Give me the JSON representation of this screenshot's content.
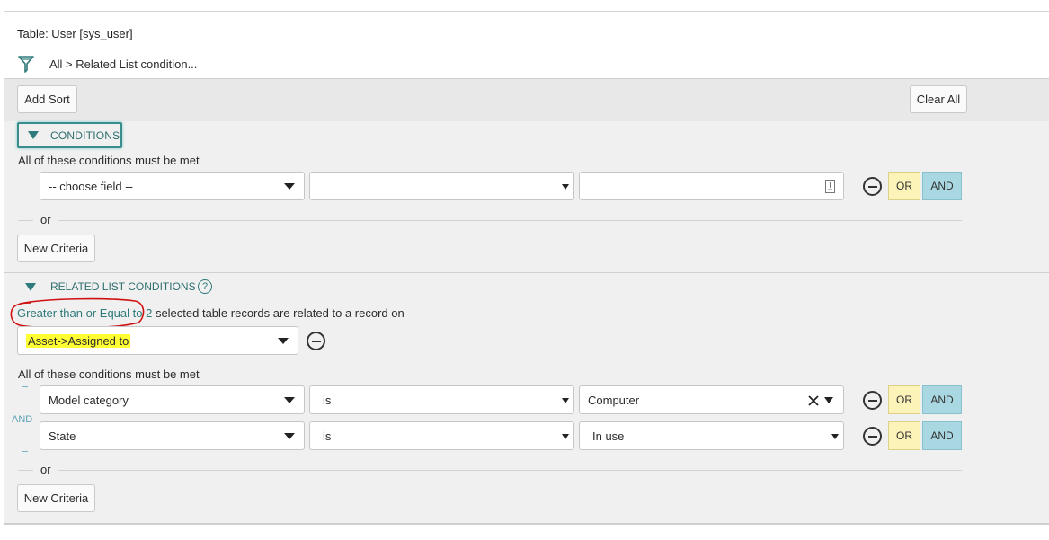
{
  "header": {
    "table_label": "Table: User [sys_user]",
    "breadcrumb": "All > Related List condition..."
  },
  "toolbar": {
    "add_sort": "Add Sort",
    "clear_all": "Clear All"
  },
  "conditions": {
    "toggle_label": "CONDITIONS",
    "must_be_met": "All of these conditions must be met",
    "row": {
      "field": "-- choose field --",
      "operator": "",
      "value": "",
      "or": "OR",
      "and": "AND"
    },
    "or_separator": "or",
    "new_criteria": "New Criteria"
  },
  "related": {
    "title": "RELATED LIST CONDITIONS",
    "help": "?",
    "quantity_link": "Greater than or Equal to 2",
    "quantity_suffix": "selected table records are related to a record on",
    "related_field": "Asset->Assigned to",
    "must_be_met": "All of these conditions must be met",
    "and_bracket_label": "AND",
    "rows": [
      {
        "field": "Model category",
        "operator": "is",
        "value": "Computer",
        "or": "OR",
        "and": "AND"
      },
      {
        "field": "State",
        "operator": "is",
        "value": "In use",
        "or": "OR",
        "and": "AND"
      }
    ],
    "or_separator": "or",
    "new_criteria": "New Criteria"
  },
  "colors": {
    "accent": "#2f7a7a",
    "or_button": "#fbf3b8",
    "and_button": "#a9d8e2",
    "highlight": "#ffff33",
    "annotation": "#d01010"
  }
}
